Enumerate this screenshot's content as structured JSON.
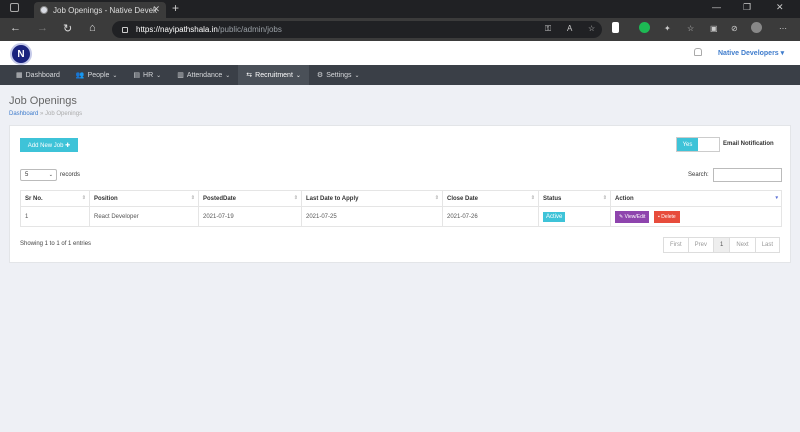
{
  "browser": {
    "tab_title": "Job Openings - Native Developers",
    "url_host": "https://nayipathshala.in",
    "url_path": "/public/admin/jobs"
  },
  "header": {
    "logo_letter": "N",
    "user_name": "Native Developers"
  },
  "nav": {
    "items": [
      {
        "label": "Dashboard",
        "icon": "dashboard-icon"
      },
      {
        "label": "People",
        "icon": "people-icon"
      },
      {
        "label": "HR",
        "icon": "hr-icon"
      },
      {
        "label": "Attendance",
        "icon": "attendance-icon"
      },
      {
        "label": "Recruitment",
        "icon": "recruitment-icon"
      },
      {
        "label": "Settings",
        "icon": "settings-icon"
      }
    ]
  },
  "page": {
    "title": "Job Openings",
    "breadcrumb_link": "Dashboard",
    "breadcrumb_sep": "»",
    "breadcrumb_current": "Job Openings"
  },
  "controls": {
    "add_button": "Add New Job ✚",
    "toggle_on": "Yes",
    "email_notification": "Email Notification",
    "page_length": "5",
    "records_label": "records",
    "search_label": "Search:"
  },
  "table": {
    "headers": [
      "Sr No.",
      "Position",
      "PostedDate",
      "Last Date to Apply",
      "Close Date",
      "Status",
      "Action"
    ],
    "rows": [
      {
        "sr": "1",
        "position": "React Developer",
        "posted": "2021-07-19",
        "last_date": "2021-07-25",
        "close_date": "2021-07-26",
        "status": "Active",
        "edit_label": "View/Edit",
        "delete_label": "Delete"
      }
    ]
  },
  "footer": {
    "info": "Showing 1 to 1 of 1 entries",
    "pages": [
      "First",
      "Prev",
      "1",
      "Next",
      "Last"
    ]
  },
  "colors": {
    "accent": "#3ec3d8",
    "nav_bg": "#3a3f47",
    "edit": "#8e44ad",
    "delete": "#e74c3c"
  }
}
